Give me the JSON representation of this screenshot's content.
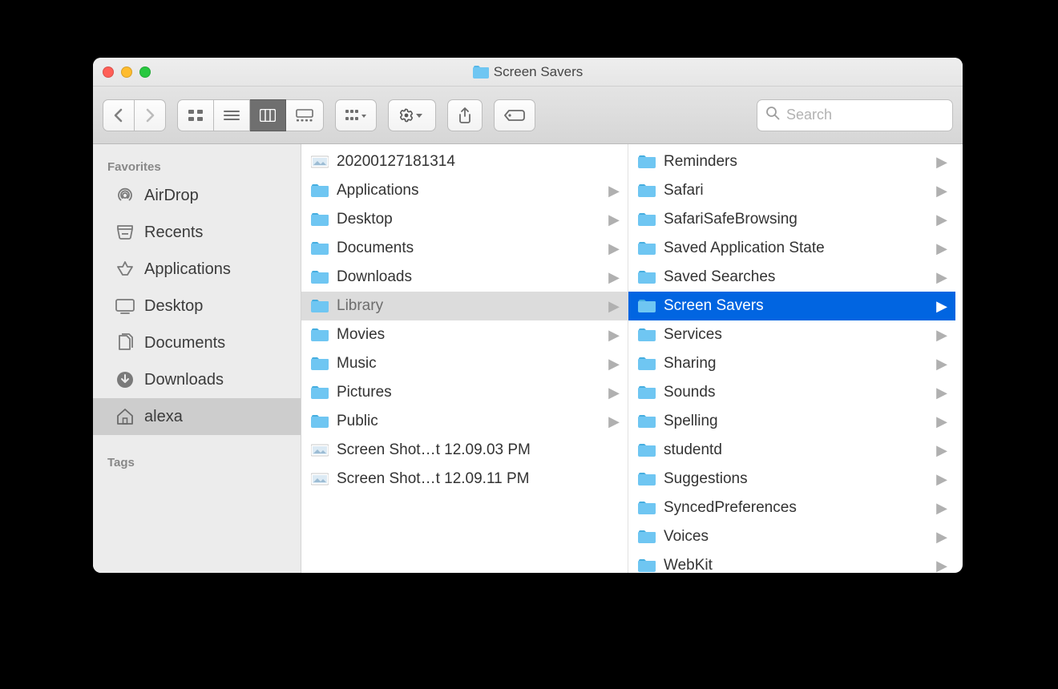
{
  "window": {
    "title": "Screen Savers",
    "title_icon": "folder-icon"
  },
  "traffic": {
    "close": "close",
    "minimize": "minimize",
    "zoom": "zoom"
  },
  "search": {
    "placeholder": "Search"
  },
  "sidebar": {
    "heading_favorites": "Favorites",
    "heading_tags": "Tags",
    "items": [
      {
        "icon": "airdrop-icon",
        "label": "AirDrop"
      },
      {
        "icon": "recents-icon",
        "label": "Recents"
      },
      {
        "icon": "applications-icon",
        "label": "Applications"
      },
      {
        "icon": "desktop-icon",
        "label": "Desktop"
      },
      {
        "icon": "documents-icon",
        "label": "Documents"
      },
      {
        "icon": "downloads-icon",
        "label": "Downloads"
      },
      {
        "icon": "home-icon",
        "label": "alexa",
        "selected": true
      }
    ]
  },
  "columns": [
    {
      "items": [
        {
          "label": "20200127181314",
          "type": "image"
        },
        {
          "label": "Applications",
          "type": "folder",
          "expandable": true
        },
        {
          "label": "Desktop",
          "type": "folder",
          "expandable": true
        },
        {
          "label": "Documents",
          "type": "folder",
          "expandable": true
        },
        {
          "label": "Downloads",
          "type": "folder",
          "expandable": true
        },
        {
          "label": "Library",
          "type": "folder",
          "expandable": true,
          "open": true
        },
        {
          "label": "Movies",
          "type": "folder",
          "expandable": true
        },
        {
          "label": "Music",
          "type": "folder",
          "expandable": true
        },
        {
          "label": "Pictures",
          "type": "folder",
          "expandable": true
        },
        {
          "label": "Public",
          "type": "folder",
          "expandable": true
        },
        {
          "label": "Screen Shot…t 12.09.03 PM",
          "type": "image"
        },
        {
          "label": "Screen Shot…t 12.09.11 PM",
          "type": "image"
        }
      ]
    },
    {
      "items": [
        {
          "label": "Reminders",
          "type": "folder",
          "expandable": true
        },
        {
          "label": "Safari",
          "type": "folder",
          "expandable": true
        },
        {
          "label": "SafariSafeBrowsing",
          "type": "folder",
          "expandable": true
        },
        {
          "label": "Saved Application State",
          "type": "folder",
          "expandable": true
        },
        {
          "label": "Saved Searches",
          "type": "folder",
          "expandable": true
        },
        {
          "label": "Screen Savers",
          "type": "folder",
          "expandable": true,
          "selected": true
        },
        {
          "label": "Services",
          "type": "folder",
          "expandable": true
        },
        {
          "label": "Sharing",
          "type": "folder",
          "expandable": true
        },
        {
          "label": "Sounds",
          "type": "folder",
          "expandable": true
        },
        {
          "label": "Spelling",
          "type": "folder",
          "expandable": true
        },
        {
          "label": "studentd",
          "type": "folder",
          "expandable": true
        },
        {
          "label": "Suggestions",
          "type": "folder",
          "expandable": true
        },
        {
          "label": "SyncedPreferences",
          "type": "folder",
          "expandable": true
        },
        {
          "label": "Voices",
          "type": "folder",
          "expandable": true
        },
        {
          "label": "WebKit",
          "type": "folder",
          "expandable": true
        }
      ]
    }
  ]
}
